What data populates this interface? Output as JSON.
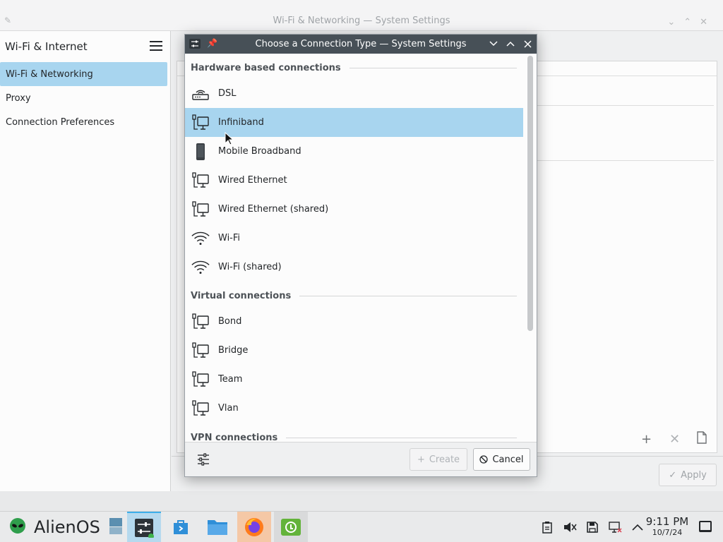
{
  "background_window": {
    "title": "Wi-Fi & Networking — System Settings",
    "sidebar": {
      "header": "Wi-Fi & Internet",
      "items": [
        {
          "label": "Wi-Fi & Networking",
          "active": true
        },
        {
          "label": "Proxy",
          "active": false
        },
        {
          "label": "Connection Preferences",
          "active": false
        }
      ]
    },
    "apply_label": "Apply"
  },
  "dialog": {
    "title": "Choose a Connection Type — System Settings",
    "sections": [
      {
        "header": "Hardware based connections",
        "items": [
          {
            "label": "DSL",
            "icon": "dsl-modem-icon"
          },
          {
            "label": "Infiniband",
            "icon": "wired-network-icon",
            "selected": true
          },
          {
            "label": "Mobile Broadband",
            "icon": "mobile-phone-icon"
          },
          {
            "label": "Wired Ethernet",
            "icon": "wired-network-icon"
          },
          {
            "label": "Wired Ethernet (shared)",
            "icon": "wired-network-icon"
          },
          {
            "label": "Wi-Fi",
            "icon": "wifi-icon"
          },
          {
            "label": "Wi-Fi (shared)",
            "icon": "wifi-icon"
          }
        ]
      },
      {
        "header": "Virtual connections",
        "items": [
          {
            "label": "Bond",
            "icon": "wired-network-icon"
          },
          {
            "label": "Bridge",
            "icon": "wired-network-icon"
          },
          {
            "label": "Team",
            "icon": "wired-network-icon"
          },
          {
            "label": "Vlan",
            "icon": "wired-network-icon"
          }
        ]
      },
      {
        "header": "VPN connections",
        "items": []
      }
    ],
    "create_label": "Create",
    "cancel_label": "Cancel"
  },
  "taskbar": {
    "os_name": "AlienOS",
    "clock_time": "9:11 PM",
    "clock_date": "10/7/24"
  },
  "colors": {
    "selection": "#a8d5ef",
    "titlebar": "#475057",
    "accent": "#3daee9"
  }
}
